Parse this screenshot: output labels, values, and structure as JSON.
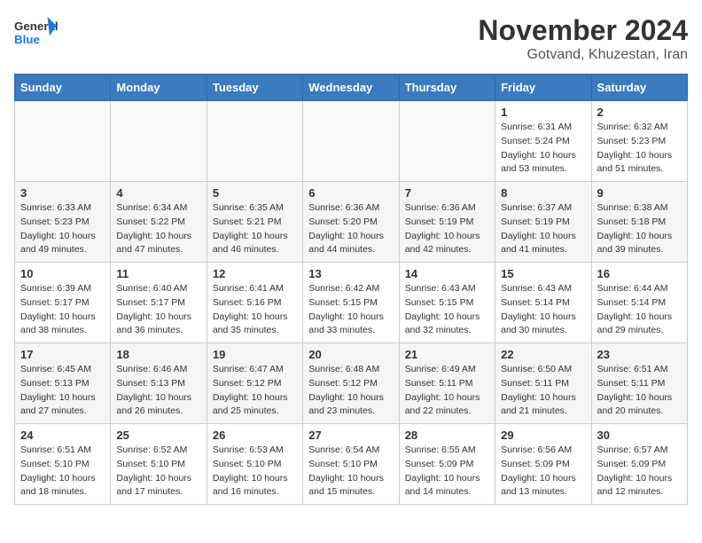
{
  "header": {
    "logo_general": "General",
    "logo_blue": "Blue",
    "month_title": "November 2024",
    "location": "Gotvand, Khuzestan, Iran"
  },
  "weekdays": [
    "Sunday",
    "Monday",
    "Tuesday",
    "Wednesday",
    "Thursday",
    "Friday",
    "Saturday"
  ],
  "weeks": [
    [
      {
        "day": "",
        "info": ""
      },
      {
        "day": "",
        "info": ""
      },
      {
        "day": "",
        "info": ""
      },
      {
        "day": "",
        "info": ""
      },
      {
        "day": "",
        "info": ""
      },
      {
        "day": "1",
        "info": "Sunrise: 6:31 AM\nSunset: 5:24 PM\nDaylight: 10 hours\nand 53 minutes."
      },
      {
        "day": "2",
        "info": "Sunrise: 6:32 AM\nSunset: 5:23 PM\nDaylight: 10 hours\nand 51 minutes."
      }
    ],
    [
      {
        "day": "3",
        "info": "Sunrise: 6:33 AM\nSunset: 5:23 PM\nDaylight: 10 hours\nand 49 minutes."
      },
      {
        "day": "4",
        "info": "Sunrise: 6:34 AM\nSunset: 5:22 PM\nDaylight: 10 hours\nand 47 minutes."
      },
      {
        "day": "5",
        "info": "Sunrise: 6:35 AM\nSunset: 5:21 PM\nDaylight: 10 hours\nand 46 minutes."
      },
      {
        "day": "6",
        "info": "Sunrise: 6:36 AM\nSunset: 5:20 PM\nDaylight: 10 hours\nand 44 minutes."
      },
      {
        "day": "7",
        "info": "Sunrise: 6:36 AM\nSunset: 5:19 PM\nDaylight: 10 hours\nand 42 minutes."
      },
      {
        "day": "8",
        "info": "Sunrise: 6:37 AM\nSunset: 5:19 PM\nDaylight: 10 hours\nand 41 minutes."
      },
      {
        "day": "9",
        "info": "Sunrise: 6:38 AM\nSunset: 5:18 PM\nDaylight: 10 hours\nand 39 minutes."
      }
    ],
    [
      {
        "day": "10",
        "info": "Sunrise: 6:39 AM\nSunset: 5:17 PM\nDaylight: 10 hours\nand 38 minutes."
      },
      {
        "day": "11",
        "info": "Sunrise: 6:40 AM\nSunset: 5:17 PM\nDaylight: 10 hours\nand 36 minutes."
      },
      {
        "day": "12",
        "info": "Sunrise: 6:41 AM\nSunset: 5:16 PM\nDaylight: 10 hours\nand 35 minutes."
      },
      {
        "day": "13",
        "info": "Sunrise: 6:42 AM\nSunset: 5:15 PM\nDaylight: 10 hours\nand 33 minutes."
      },
      {
        "day": "14",
        "info": "Sunrise: 6:43 AM\nSunset: 5:15 PM\nDaylight: 10 hours\nand 32 minutes."
      },
      {
        "day": "15",
        "info": "Sunrise: 6:43 AM\nSunset: 5:14 PM\nDaylight: 10 hours\nand 30 minutes."
      },
      {
        "day": "16",
        "info": "Sunrise: 6:44 AM\nSunset: 5:14 PM\nDaylight: 10 hours\nand 29 minutes."
      }
    ],
    [
      {
        "day": "17",
        "info": "Sunrise: 6:45 AM\nSunset: 5:13 PM\nDaylight: 10 hours\nand 27 minutes."
      },
      {
        "day": "18",
        "info": "Sunrise: 6:46 AM\nSunset: 5:13 PM\nDaylight: 10 hours\nand 26 minutes."
      },
      {
        "day": "19",
        "info": "Sunrise: 6:47 AM\nSunset: 5:12 PM\nDaylight: 10 hours\nand 25 minutes."
      },
      {
        "day": "20",
        "info": "Sunrise: 6:48 AM\nSunset: 5:12 PM\nDaylight: 10 hours\nand 23 minutes."
      },
      {
        "day": "21",
        "info": "Sunrise: 6:49 AM\nSunset: 5:11 PM\nDaylight: 10 hours\nand 22 minutes."
      },
      {
        "day": "22",
        "info": "Sunrise: 6:50 AM\nSunset: 5:11 PM\nDaylight: 10 hours\nand 21 minutes."
      },
      {
        "day": "23",
        "info": "Sunrise: 6:51 AM\nSunset: 5:11 PM\nDaylight: 10 hours\nand 20 minutes."
      }
    ],
    [
      {
        "day": "24",
        "info": "Sunrise: 6:51 AM\nSunset: 5:10 PM\nDaylight: 10 hours\nand 18 minutes."
      },
      {
        "day": "25",
        "info": "Sunrise: 6:52 AM\nSunset: 5:10 PM\nDaylight: 10 hours\nand 17 minutes."
      },
      {
        "day": "26",
        "info": "Sunrise: 6:53 AM\nSunset: 5:10 PM\nDaylight: 10 hours\nand 16 minutes."
      },
      {
        "day": "27",
        "info": "Sunrise: 6:54 AM\nSunset: 5:10 PM\nDaylight: 10 hours\nand 15 minutes."
      },
      {
        "day": "28",
        "info": "Sunrise: 6:55 AM\nSunset: 5:09 PM\nDaylight: 10 hours\nand 14 minutes."
      },
      {
        "day": "29",
        "info": "Sunrise: 6:56 AM\nSunset: 5:09 PM\nDaylight: 10 hours\nand 13 minutes."
      },
      {
        "day": "30",
        "info": "Sunrise: 6:57 AM\nSunset: 5:09 PM\nDaylight: 10 hours\nand 12 minutes."
      }
    ]
  ]
}
